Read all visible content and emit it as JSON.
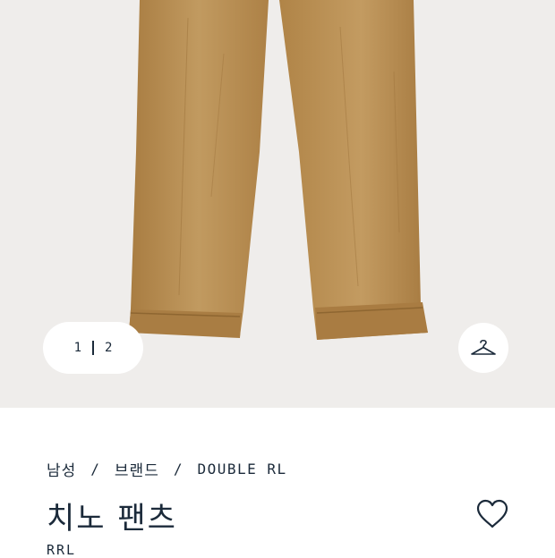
{
  "gallery": {
    "image_alt": "치노 팬츠",
    "pager": {
      "current": "1",
      "total": "2"
    },
    "hanger_icon": "hanger-icon"
  },
  "breadcrumb": {
    "items": [
      "남성",
      "브랜드",
      "DOUBLE RL"
    ],
    "separator": "/"
  },
  "product": {
    "title": "치노 팬츠",
    "brand": "RRL",
    "wishlist_icon": "heart-outline-icon"
  },
  "colors": {
    "gallery_bg": "#efedeb",
    "text": "#1b2a3a",
    "pants": "#b98e52"
  }
}
